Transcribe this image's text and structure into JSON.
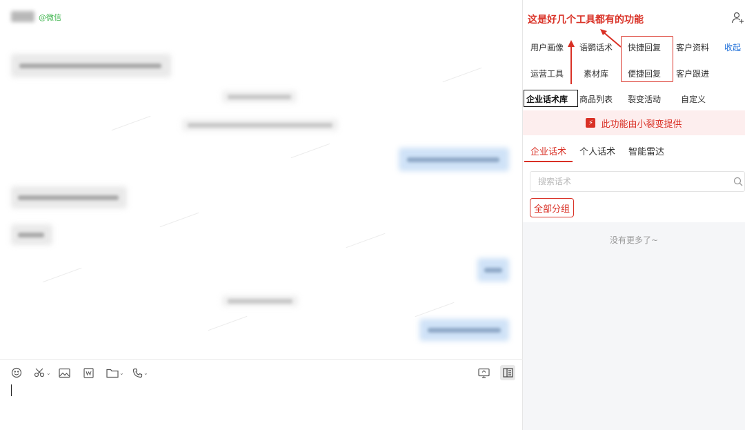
{
  "chat": {
    "contact_source": "@微信"
  },
  "annotation": {
    "note": "这是好几个工具都有的功能",
    "color": "#d93025"
  },
  "sidebar": {
    "row1": [
      "用户画像",
      "语鹦话术",
      "快捷回复",
      "客户资料"
    ],
    "collapse_label": "收起",
    "row2": [
      "运营工具",
      "素材库",
      "便捷回复",
      "客户跟进"
    ],
    "row3": [
      "企业话术库",
      "商品列表",
      "裂变活动",
      "自定义"
    ],
    "banner_text": "此功能由小裂变提供",
    "subtabs": [
      "企业话术",
      "个人话术",
      "智能雷达"
    ],
    "active_subtab": "企业话术",
    "search_placeholder": "搜索话术",
    "group_filter": "全部分组",
    "empty_text": "没有更多了~"
  },
  "icons": {
    "toolbar": [
      "emoji-icon",
      "scissors-icon",
      "image-icon",
      "word-doc-icon",
      "folder-icon",
      "phone-icon",
      "screen-share-icon",
      "sidebar-panel-icon"
    ],
    "header": [
      "add-contact-icon"
    ],
    "search": "search-icon",
    "banner": "xiaolibian-logo-icon"
  },
  "colors": {
    "accent_red": "#d93025",
    "link_blue": "#1e6fd9",
    "source_green": "#3bb34a",
    "outgoing_bubble": "#cfe2f7"
  }
}
